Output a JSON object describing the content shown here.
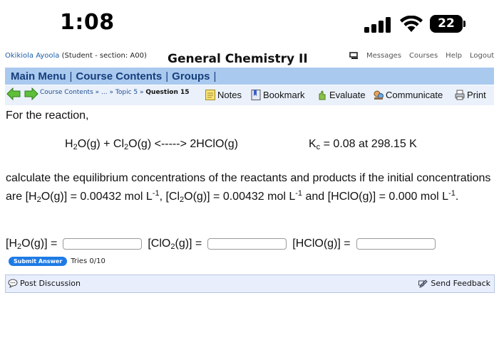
{
  "status_bar": {
    "time": "1:08",
    "battery": "22"
  },
  "header": {
    "user_name": "Okikiola Ayoola",
    "user_role": "(Student  - section: A00)",
    "title": "General Chemistry II",
    "links": [
      "Messages",
      "Courses",
      "Help",
      "Logout"
    ]
  },
  "menu": {
    "items": [
      "Main Menu",
      "Course Contents",
      "Groups"
    ]
  },
  "toolbar": {
    "crumb_1": "Course Contents",
    "crumb_sep": "»",
    "crumb_2": "...",
    "crumb_3": "Topic 5",
    "crumb_4": "Question 15",
    "tools": [
      "Notes",
      "Bookmark",
      "Evaluate",
      "Communicate",
      "Print"
    ]
  },
  "problem": {
    "intro": "For the reaction,",
    "kc_value": "= 0.08 at 298.15 K",
    "question_text_1": "calculate the equilibrium concentrations of the reactants and products if the initial concentrations are ",
    "init_h2o_value": ")] = 0.00432 mol L",
    "init_cl2o_value": ")] = 0.00432 mol L",
    "init_hclo_value": ")] = 0.000 mol L",
    "unit_exponent": "-1"
  },
  "answer": {
    "submit_label": "Submit Answer",
    "tries": "Tries 0/10"
  },
  "footer": {
    "post_discussion": "Post Discussion",
    "send_feedback": "Send Feedback"
  },
  "colors": {
    "menu_bar": "#a9c9ef",
    "menu_text": "#163e7a",
    "submit_button": "#1e7be6",
    "footer_bar": "#e8eefc"
  }
}
